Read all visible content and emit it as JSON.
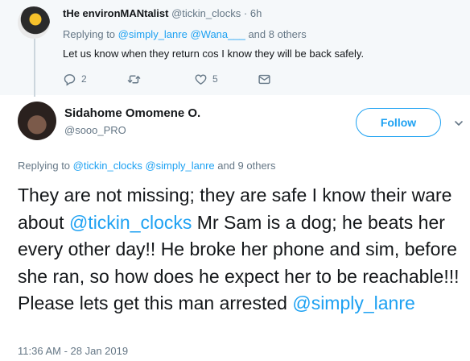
{
  "parent_tweet": {
    "author_name": "tHe environMANtalist",
    "author_handle": "@tickin_clocks",
    "time": "6h",
    "replying_prefix": "Replying to ",
    "reply_mentions": [
      "@simply_lanre",
      "@Wana___"
    ],
    "reply_suffix": " and 8 others",
    "text": "Let us know  when they return cos I know they will be back safely.",
    "reply_count": "2",
    "retweet_count": "",
    "like_count": "5"
  },
  "main_tweet": {
    "author_name": "Sidahome Omomene O.",
    "author_handle": "@sooo_PRO",
    "follow_label": "Follow",
    "replying_prefix": "Replying to ",
    "reply_mentions": [
      "@tickin_clocks",
      "@simply_lanre"
    ],
    "reply_suffix": " and 9 others",
    "text_part1": "They are not missing; they are safe I know their ware about ",
    "mention1": "@tickin_clocks",
    "text_part2": " Mr Sam is a dog; he beats her every other day!! He broke her phone and sim, before she ran, so how does he expect her to be reachable!!! Please lets get this man arrested ",
    "mention2": "@simply_lanre",
    "timestamp": "11:36 AM - 28 Jan 2019"
  },
  "colors": {
    "link": "#1da1f2",
    "muted": "#657786",
    "text": "#14171a",
    "parent_bg": "#f5f8fa"
  },
  "icons": {
    "reply": "reply-icon",
    "retweet": "retweet-icon",
    "like": "heart-icon",
    "dm": "envelope-icon",
    "more": "chevron-down-icon"
  }
}
